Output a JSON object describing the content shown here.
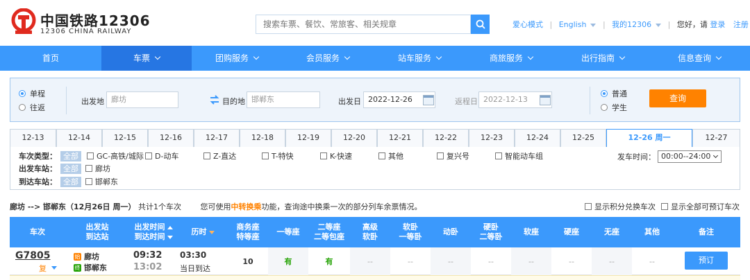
{
  "header": {
    "brand_cn": "中国铁路12306",
    "brand_en": "12306 CHINA RAILWAY",
    "search_placeholder": "搜索车票、餐饮、常旅客、相关规章",
    "links": {
      "care_mode": "爱心模式",
      "english": "English",
      "my12306": "我的12306",
      "greeting": "您好，请",
      "login": "登录",
      "register": "注册"
    }
  },
  "nav": {
    "items": [
      {
        "label": "首页"
      },
      {
        "label": "车票"
      },
      {
        "label": "团购服务"
      },
      {
        "label": "会员服务"
      },
      {
        "label": "站车服务"
      },
      {
        "label": "商旅服务"
      },
      {
        "label": "出行指南"
      },
      {
        "label": "信息查询"
      }
    ]
  },
  "query": {
    "trip_oneway": "单程",
    "trip_round": "往返",
    "from_label": "出发地",
    "from_value": "廊坊",
    "to_label": "目的地",
    "to_value": "邯郸东",
    "depart_label": "出发日",
    "depart_value": "2022-12-26",
    "return_label": "返程日",
    "return_value": "2022-12-13",
    "type_normal": "普通",
    "type_student": "学生",
    "search_button": "查询"
  },
  "date_tabs": [
    "12-13",
    "12-14",
    "12-15",
    "12-16",
    "12-17",
    "12-18",
    "12-19",
    "12-20",
    "12-21",
    "12-22",
    "12-23",
    "12-24",
    "12-25",
    "12-26 周一",
    "12-27"
  ],
  "filters": {
    "type_label": "车次类型：",
    "all": "全部",
    "types": [
      "GC-高铁/城际",
      "D-动车",
      "Z-直达",
      "T-特快",
      "K-快速",
      "其他",
      "复兴号",
      "智能动车组"
    ],
    "from_label": "出发车站：",
    "from_station": "廊坊",
    "to_label": "到达车站：",
    "to_station": "邯郸东",
    "time_label": "发车时间：",
    "time_value": "00:00--24:00"
  },
  "summary": {
    "route": "廊坊 --> 邯郸东（12月26日 周一）",
    "count": "共计1个车次",
    "hint_pre": "您可使用",
    "hint_hl": "中转换乘",
    "hint_post": "功能，查询途中换乘一次的部分列车余票情况。",
    "opt_points": "显示积分兑换车次",
    "opt_all": "显示全部可预订车次"
  },
  "table": {
    "headers": {
      "train": "车次",
      "stations_1": "出发站",
      "stations_2": "到达站",
      "times_1": "出发时间",
      "times_2": "到达时间",
      "duration": "历时",
      "business_1": "商务座",
      "business_2": "特等座",
      "first": "一等座",
      "second_1": "二等座",
      "second_2": "二等包座",
      "soft_sleeper_hi_1": "高级",
      "soft_sleeper_hi_2": "软卧",
      "soft_sleeper_1": "软卧",
      "soft_sleeper_2": "一等卧",
      "move_sleeper": "动卧",
      "hard_sleeper_1": "硬卧",
      "hard_sleeper_2": "二等卧",
      "soft_seat": "软座",
      "hard_seat": "硬座",
      "no_seat": "无座",
      "other": "其他",
      "note": "备注"
    },
    "row": {
      "train_no": "G7805",
      "fu": "复",
      "from_badge": "始",
      "from": "廊坊",
      "to_badge": "终",
      "to": "邯郸东",
      "depart": "09:32",
      "arrive": "13:02",
      "duration": "03:30",
      "arrive_day": "当日到达",
      "business": "10",
      "first": "有",
      "second": "有",
      "empty": "--",
      "book": "预订"
    }
  },
  "colors": {
    "primary": "#3b99fc",
    "accent_orange": "#ff8200",
    "available_green": "#26a306"
  }
}
